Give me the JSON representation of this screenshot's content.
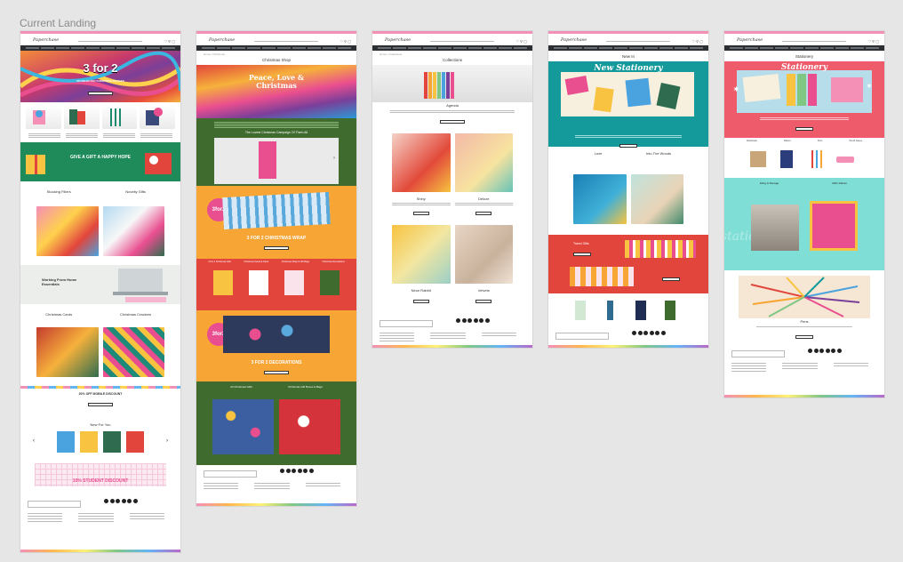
{
  "canvas": {
    "title": "Current Landing"
  },
  "frames": [
    {
      "id": "home",
      "hero_text": "3 for 2",
      "hero_sub": "ON SELECTED CHRISTMAS RANGES",
      "green_banner": "GIVE A GIFT A HAPPY HOPE",
      "tiles_1": [
        "Stocking Fillers",
        "Novelty Gifts"
      ],
      "working": "Working From Home Essentials",
      "tiles_2": [
        "Christmas Cards",
        "Christmas Crackers"
      ],
      "discount_band": "20% OFF MOBILE DISCOUNT",
      "new_for_you": "New For You",
      "student": "10% STUDENT DISCOUNT"
    },
    {
      "id": "christmas-shop",
      "page_title": "Christmas Shop",
      "hero_text": "Peace, Love & Christmas",
      "video_title": "The Lovest Christmas Campaign Of Them All",
      "promo_1": "3 FOR 2 CHRISTMAS WRAP",
      "cat_labels": [
        "3 For 2 Christmas Gifts",
        "Christmas Cards & Stock",
        "Christmas Wrap & Gift Bags",
        "Christmas Decorations"
      ],
      "promo_2": "3 FOR 2 DECORATIONS",
      "bottom_labels": [
        "All Christmas Gifts",
        "Christmas Gift Boxes & Bags"
      ]
    },
    {
      "id": "collections",
      "page_title": "Collections",
      "feature": "Agenda",
      "tiles_1": [
        "Shiny",
        "Deluxe"
      ],
      "tiles_2": [
        "Neon Rabbit",
        "Velvets"
      ]
    },
    {
      "id": "new-in",
      "page_title": "New In",
      "hero_text": "New Stationery",
      "pair": [
        "Luxe",
        "Into The Woods"
      ],
      "promo_label": "Travel Gifts"
    },
    {
      "id": "stationery",
      "page_title": "Stationery",
      "hero_text": "Stationery",
      "cat_labels": [
        "Notebooks",
        "Diaries",
        "Pens",
        "Pencil Cases"
      ],
      "pair": [
        "Filing & Storage",
        "2021 Diaries"
      ],
      "feature": "Pens",
      "script": "stationery"
    }
  ],
  "colors": {
    "pink": "#f48fb6",
    "navy": "#2b2f33",
    "green": "#3f6b2e",
    "orange": "#f7a535",
    "red": "#e2453c",
    "teal": "#159a9c",
    "coral": "#ee5b6a",
    "mint": "#7fded6"
  }
}
